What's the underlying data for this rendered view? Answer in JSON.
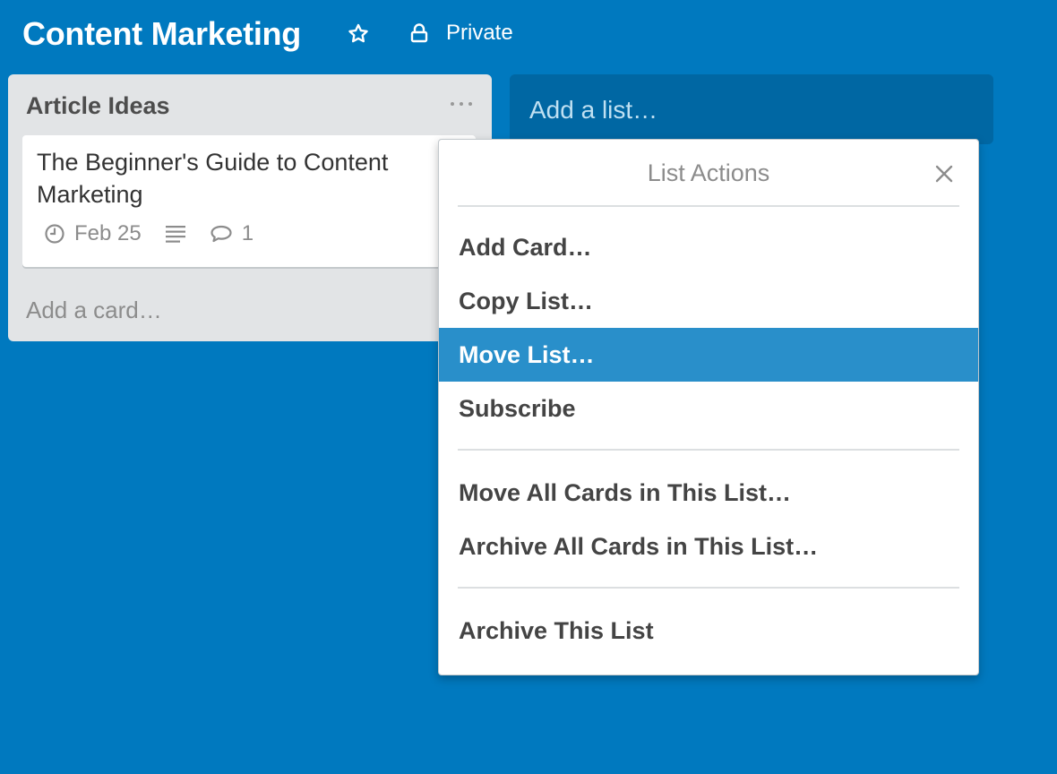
{
  "board": {
    "title": "Content Marketing",
    "visibility": "Private",
    "star_icon": "star-outline-icon",
    "visibility_icon": "lock-icon"
  },
  "lists": [
    {
      "title": "Article Ideas",
      "menu_icon": "ellipsis-icon",
      "cards": [
        {
          "title": "The Beginner's Guide to Content Marketing",
          "due_date": "Feb 25",
          "has_description": true,
          "comment_count": "1"
        }
      ],
      "add_card_label": "Add a card…"
    }
  ],
  "add_list_label": "Add a list…",
  "list_actions": {
    "title": "List Actions",
    "close_icon": "close-icon",
    "groups": [
      [
        {
          "label": "Add Card…"
        },
        {
          "label": "Copy List…"
        },
        {
          "label": "Move List…",
          "active": true
        },
        {
          "label": "Subscribe"
        }
      ],
      [
        {
          "label": "Move All Cards in This List…"
        },
        {
          "label": "Archive All Cards in This List…"
        }
      ],
      [
        {
          "label": "Archive This List"
        }
      ]
    ]
  },
  "colors": {
    "board_background": "#0079bf",
    "list_background": "#e2e4e6",
    "add_list_background": "#0067a3",
    "menu_active": "#298fca"
  }
}
